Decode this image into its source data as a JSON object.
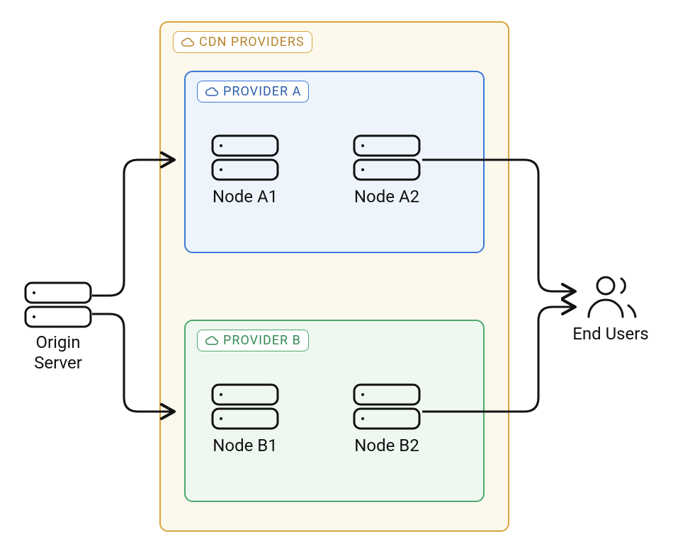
{
  "labels": {
    "origin": "Origin\nServer",
    "endUsers": "End Users",
    "cdnProviders": "CDN PROVIDERS",
    "providerA": "PROVIDER A",
    "providerB": "PROVIDER B",
    "nodeA1": "Node A1",
    "nodeA2": "Node A2",
    "nodeB1": "Node B1",
    "nodeB2": "Node B2"
  },
  "colors": {
    "outer": "#d8a43b",
    "outerFill": "#fdf8ec",
    "providerA": "#3a78d6",
    "providerAFill": "#eef4fb",
    "providerB": "#4aa96c",
    "providerBFill": "#eef8f1",
    "line": "#111111"
  },
  "diagram": {
    "components": [
      "Origin Server",
      "CDN Providers",
      "Provider A",
      "Provider B",
      "Node A1",
      "Node A2",
      "Node B1",
      "Node B2",
      "End Users"
    ],
    "edges": [
      [
        "Origin Server",
        "Provider A"
      ],
      [
        "Origin Server",
        "Provider B"
      ],
      [
        "Provider A",
        "End Users"
      ],
      [
        "Provider B",
        "End Users"
      ]
    ],
    "nesting": {
      "CDN Providers": [
        "Provider A",
        "Provider B"
      ],
      "Provider A": [
        "Node A1",
        "Node A2"
      ],
      "Provider B": [
        "Node B1",
        "Node B2"
      ]
    }
  }
}
